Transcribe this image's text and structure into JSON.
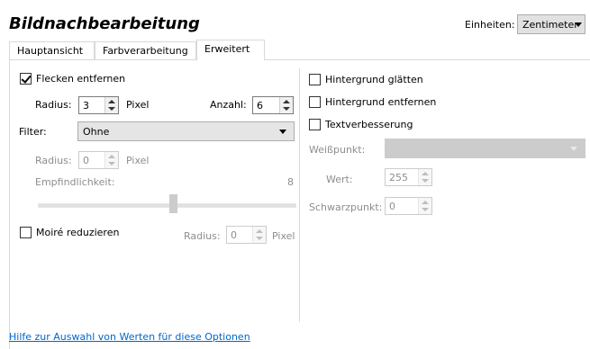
{
  "header": {
    "title": "Bildnachbearbeitung",
    "units_label": "Einheiten:",
    "units_value": "Zentimeter"
  },
  "tabs": [
    {
      "label": "Hauptansicht",
      "active": false
    },
    {
      "label": "Farbverarbeitung",
      "active": false
    },
    {
      "label": "Erweitert",
      "active": true
    }
  ],
  "left": {
    "despeckle": {
      "label": "Flecken entfernen",
      "checked": true
    },
    "radius": {
      "label": "Radius:",
      "value": "3",
      "unit": "Pixel"
    },
    "count": {
      "label": "Anzahl:",
      "value": "6"
    },
    "filter": {
      "label": "Filter:",
      "value": "Ohne"
    },
    "filter_radius": {
      "label": "Radius:",
      "value": "0",
      "unit": "Pixel"
    },
    "sensitivity": {
      "label": "Empfindlichkeit:",
      "value": "8"
    },
    "moire": {
      "label": "Moiré reduzieren",
      "checked": false
    },
    "moire_radius": {
      "label": "Radius:",
      "value": "0",
      "unit": "Pixel"
    }
  },
  "right": {
    "smooth_bg": {
      "label": "Hintergrund glätten",
      "checked": false
    },
    "remove_bg": {
      "label": "Hintergrund entfernen",
      "checked": false
    },
    "text_enhance": {
      "label": "Textverbesserung",
      "checked": false
    },
    "white_point": {
      "label": "Weißpunkt:",
      "value": ""
    },
    "value": {
      "label": "Wert:",
      "value": "255"
    },
    "black_point": {
      "label": "Schwarzpunkt:",
      "value": "0"
    }
  },
  "footer": {
    "help_link": "Hilfe zur Auswahl von Werten für diese Optionen"
  }
}
